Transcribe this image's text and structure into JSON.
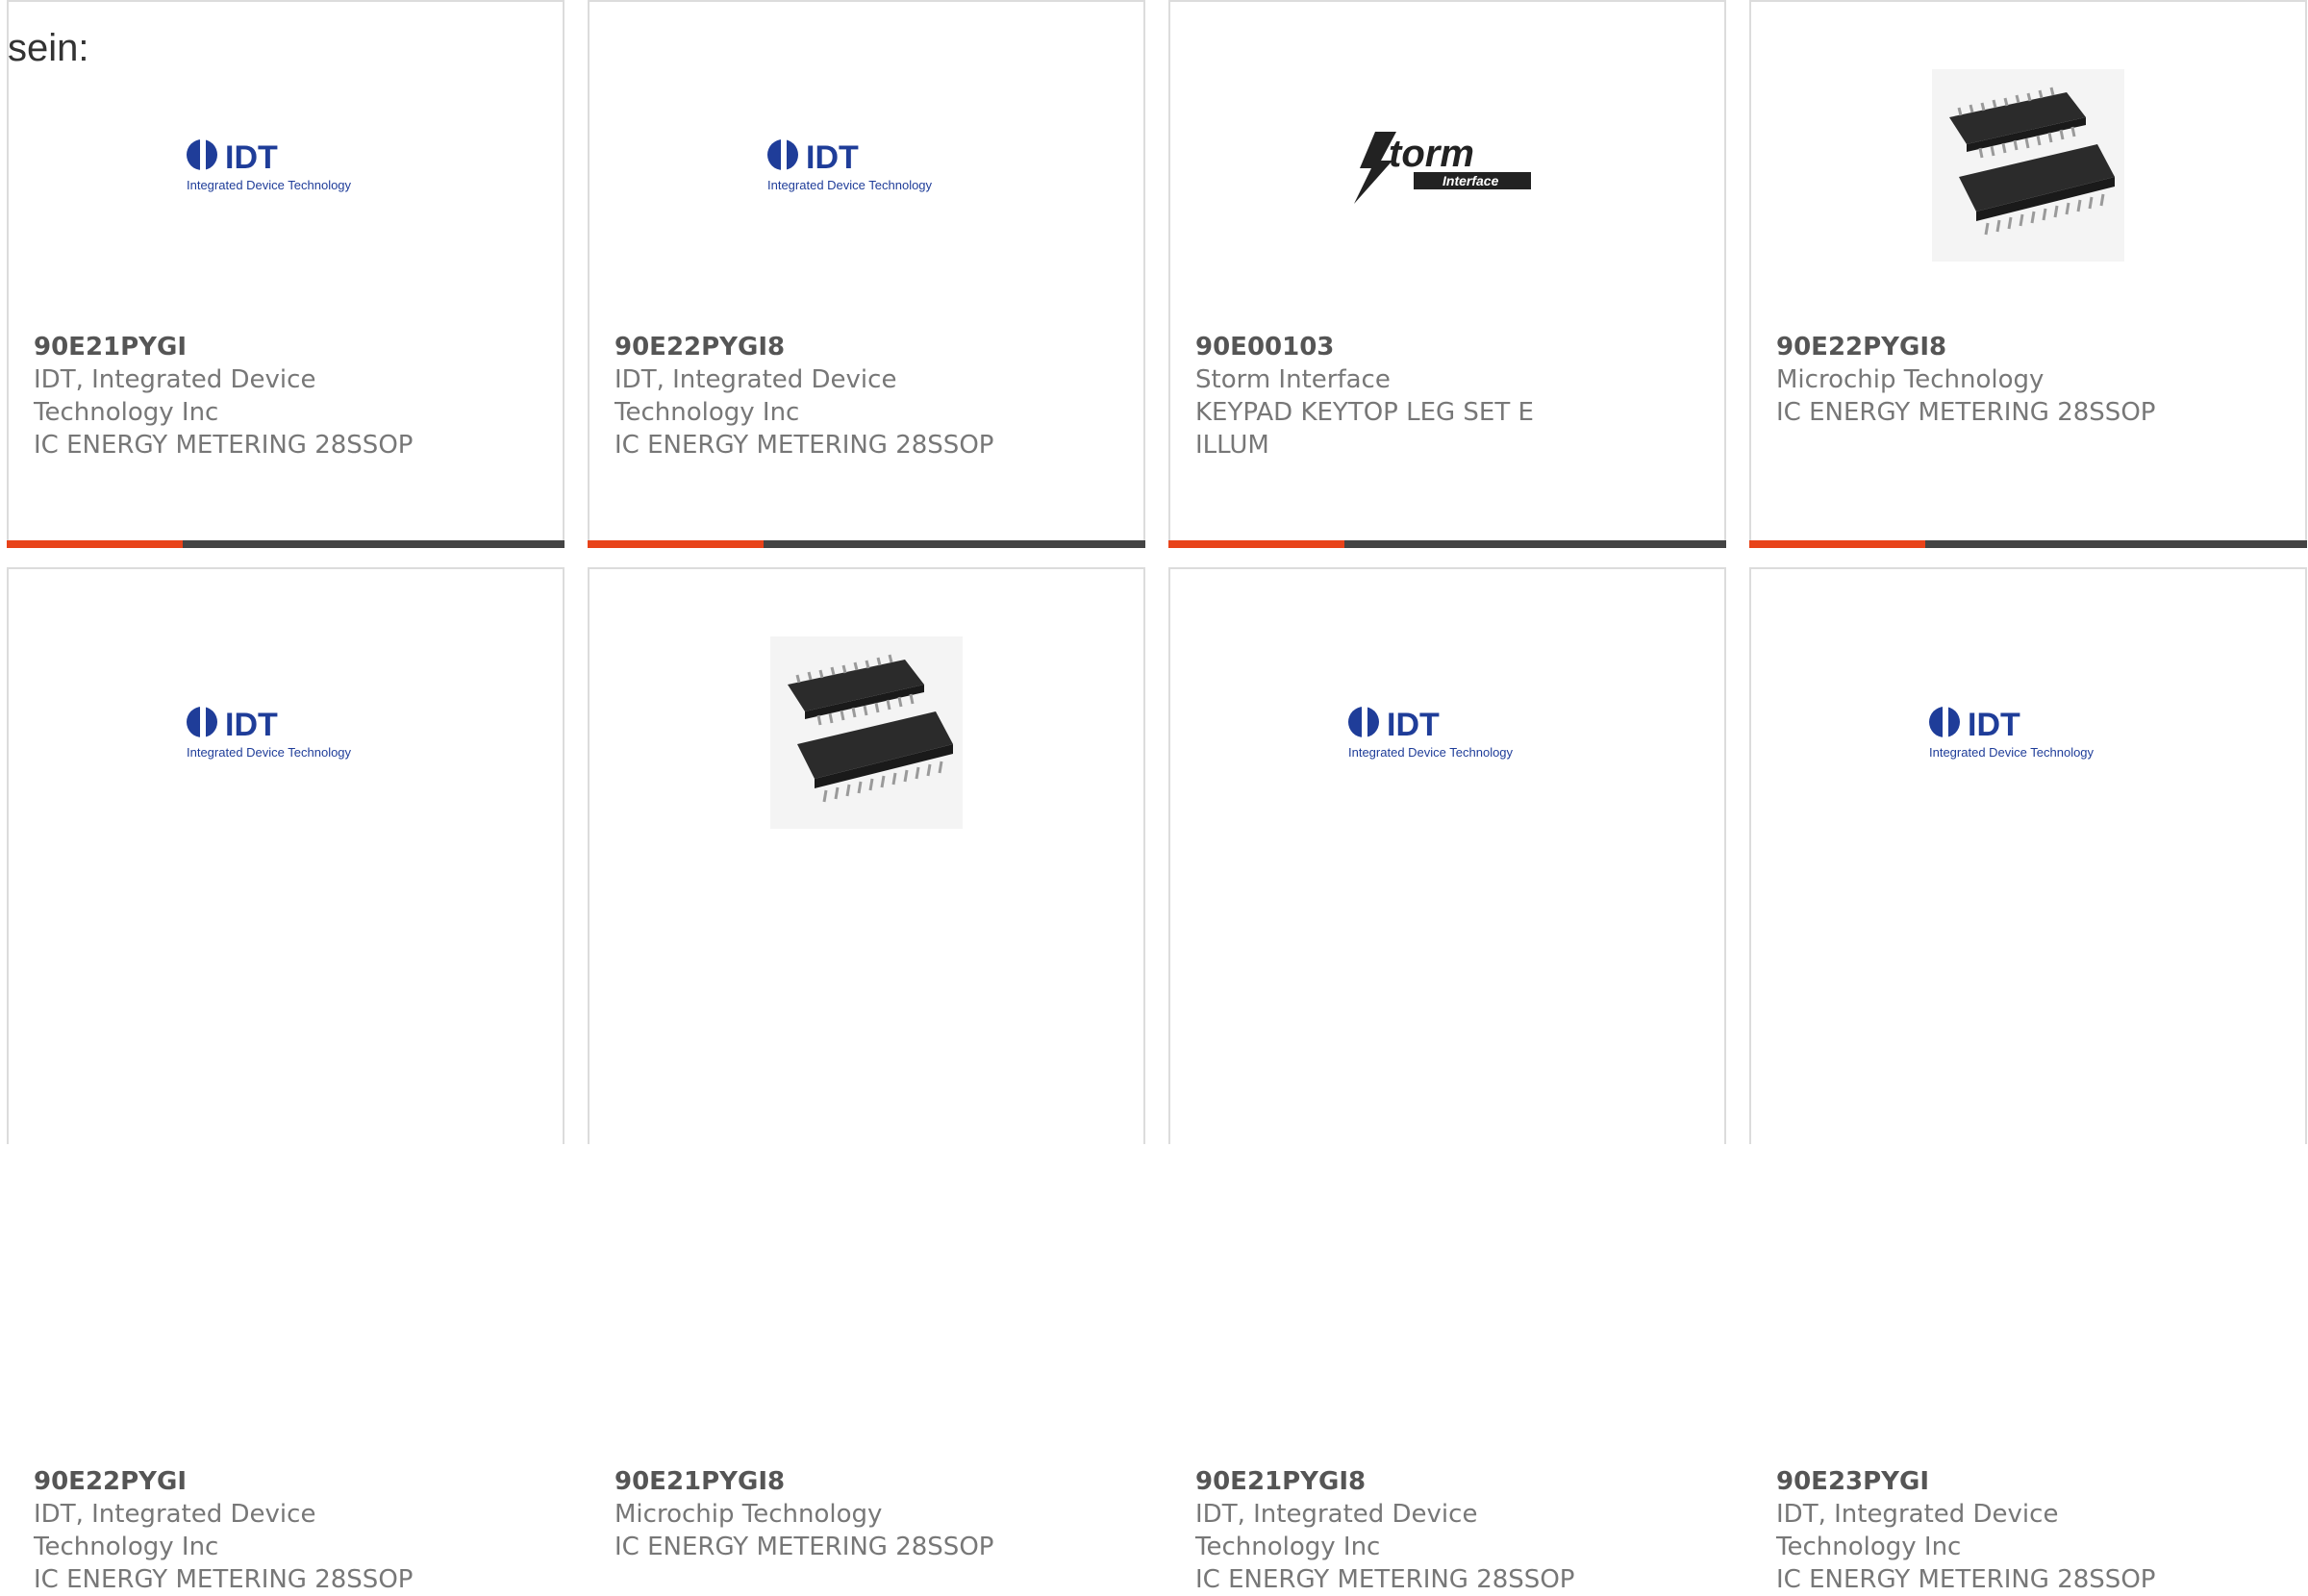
{
  "intro_text": "sein:",
  "colors": {
    "accent": "#e8431a",
    "bar": "#444444",
    "idt_blue": "#1f3d99"
  },
  "logo_text": {
    "idt_mark": "IDT",
    "idt_sub": "Integrated Device Technology",
    "storm_mark": "Storm",
    "storm_sub": "Interface"
  },
  "products": [
    {
      "part": "90E21PYGI",
      "manufacturer": "IDT, Integrated Device Technology Inc",
      "manufacturer_l1": "IDT, Integrated Device",
      "manufacturer_l2": "Technology Inc",
      "description": "IC ENERGY METERING 28SSOP",
      "image": "idt-logo"
    },
    {
      "part": "90E22PYGI8",
      "manufacturer": "IDT, Integrated Device Technology Inc",
      "manufacturer_l1": "IDT, Integrated Device",
      "manufacturer_l2": "Technology Inc",
      "description": "IC ENERGY METERING 28SSOP",
      "image": "idt-logo"
    },
    {
      "part": "90E00103",
      "manufacturer": "Storm Interface",
      "description_l1": "KEYPAD KEYTOP LEG SET E",
      "description_l2": "ILLUM",
      "image": "storm-logo"
    },
    {
      "part": "90E22PYGI8",
      "manufacturer": "Microchip Technology",
      "description": "IC ENERGY METERING 28SSOP",
      "image": "chip-photo"
    },
    {
      "part": "90E22PYGI",
      "manufacturer_l1": "IDT, Integrated Device",
      "manufacturer_l2": "Technology Inc",
      "description": "IC ENERGY METERING 28SSOP",
      "image": "idt-logo"
    },
    {
      "part": "90E21PYGI8",
      "manufacturer": "Microchip Technology",
      "description": "IC ENERGY METERING 28SSOP",
      "image": "chip-photo"
    },
    {
      "part": "90E21PYGI8",
      "manufacturer_l1": "IDT, Integrated Device",
      "manufacturer_l2": "Technology Inc",
      "description": "IC ENERGY METERING 28SSOP",
      "image": "idt-logo"
    },
    {
      "part": "90E23PYGI",
      "manufacturer_l1": "IDT, Integrated Device",
      "manufacturer_l2": "Technology Inc",
      "description": "IC ENERGY METERING 28SSOP",
      "image": "idt-logo"
    }
  ]
}
